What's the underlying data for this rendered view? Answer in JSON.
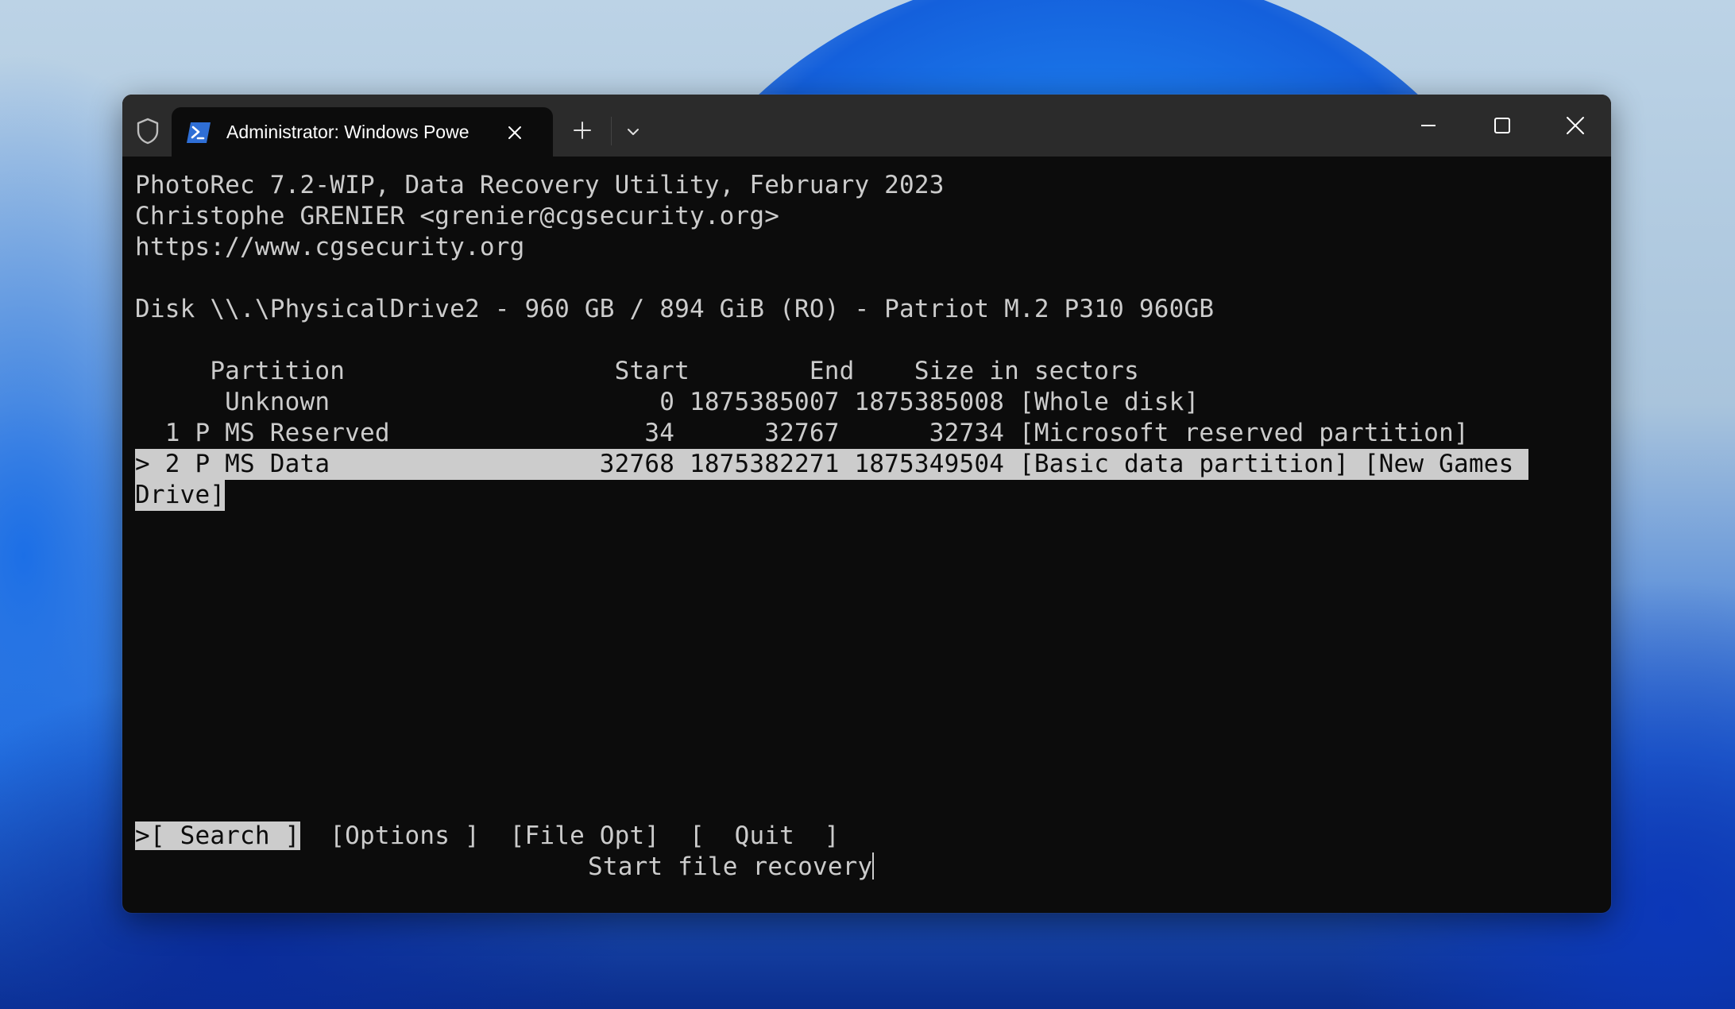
{
  "window": {
    "tab_title": "Administrator: Windows Powe",
    "icons": {
      "admin": "shield-icon",
      "tab": "powershell-icon",
      "close_tab": "close-icon",
      "new_tab": "plus-icon",
      "dropdown": "chevron-down-icon",
      "minimize": "minimize-icon",
      "maximize": "maximize-icon",
      "close": "close-icon"
    }
  },
  "terminal": {
    "header": [
      "PhotoRec 7.2-WIP, Data Recovery Utility, February 2023",
      "Christophe GRENIER <grenier@cgsecurity.org>",
      "https://www.cgsecurity.org"
    ],
    "disk": "Disk \\\\.\\PhysicalDrive2 - 960 GB / 894 GiB (RO) - Patriot M.2 P310 960GB",
    "table": {
      "columns": [
        "Partition",
        "Start",
        "End",
        "Size in sectors"
      ],
      "header_line": "     Partition                  Start        End    Size in sectors",
      "rows": [
        {
          "marker": " ",
          "number": "",
          "type": "",
          "name": "Unknown",
          "start": "0",
          "end": "1875385007",
          "size": "1875385008",
          "label": "[Whole disk]",
          "line": "      Unknown                      0 1875385007 1875385008 [Whole disk]",
          "selected": false
        },
        {
          "marker": " ",
          "number": "1",
          "type": "P",
          "name": "MS Reserved",
          "start": "34",
          "end": "32767",
          "size": "32734",
          "label": "[Microsoft reserved partition]",
          "line": "  1 P MS Reserved                 34      32767      32734 [Microsoft reserved partition]",
          "selected": false
        },
        {
          "marker": ">",
          "number": "2",
          "type": "P",
          "name": "MS Data",
          "start": "32768",
          "end": "1875382271",
          "size": "1875349504",
          "label": "[Basic data partition] [New Games Drive]",
          "line": "> 2 P MS Data                  32768 1875382271 1875349504 [Basic data partition] [New Games ",
          "line_wrap": "Drive]",
          "selected": true
        }
      ]
    },
    "menu": {
      "items": [
        {
          "label": ">[ Search ]",
          "selected": true
        },
        {
          "label": "[Options ]",
          "selected": false
        },
        {
          "label": "[File Opt]",
          "selected": false
        },
        {
          "label": "[  Quit  ]",
          "selected": false
        }
      ],
      "status": "Start file recovery"
    }
  }
}
